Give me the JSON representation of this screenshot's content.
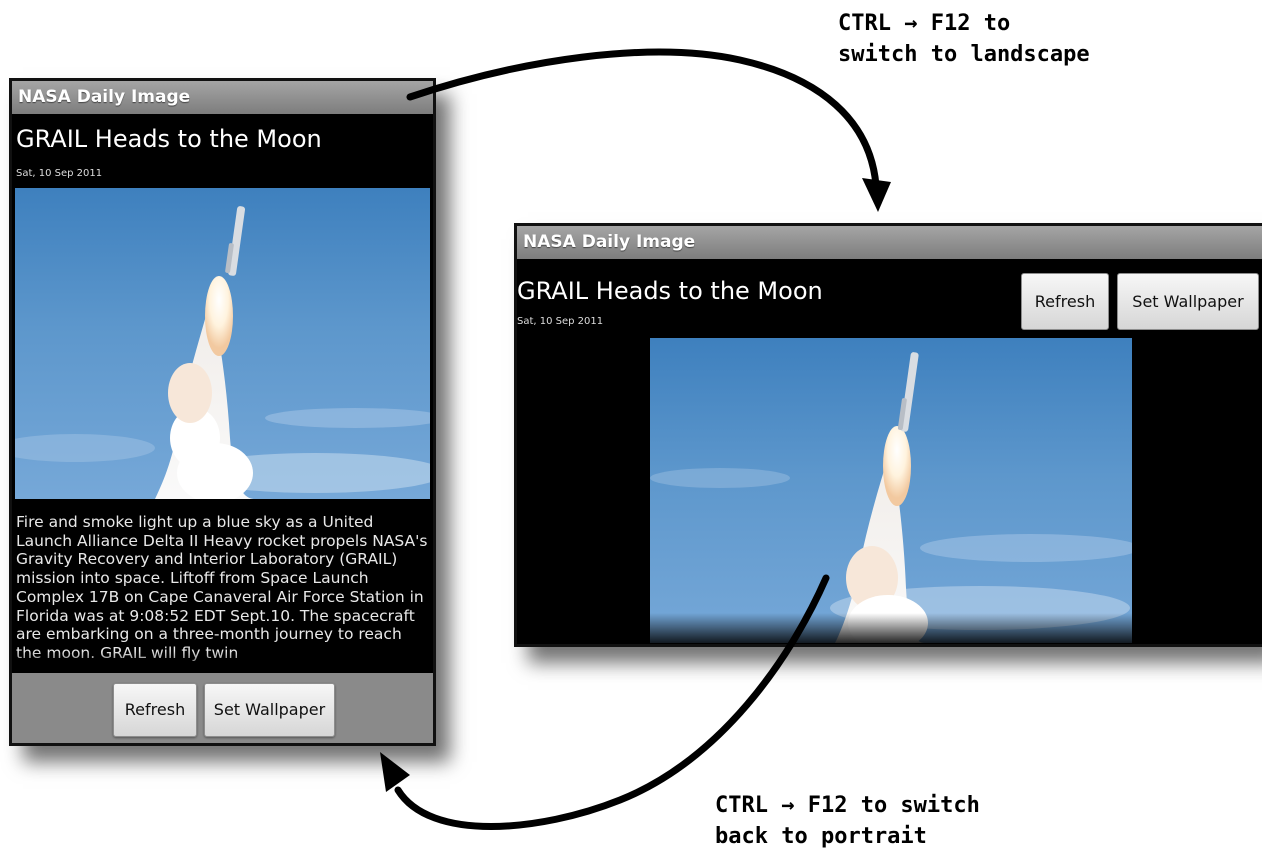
{
  "app": {
    "title": "NASA Daily Image"
  },
  "image": {
    "title": "GRAIL Heads to the Moon",
    "date": "Sat, 10 Sep 2011",
    "description": "Fire and smoke light up a blue sky as a United Launch Alliance Delta II Heavy rocket propels NASA's Gravity Recovery and Interior Laboratory (GRAIL) mission into space. Liftoff from Space Launch Complex 17B on Cape Canaveral Air Force Station in Florida was at 9:08:52 EDT Sept.10. The spacecraft are embarking on a three-month journey to reach the moon. GRAIL will fly twin"
  },
  "buttons": {
    "refresh": "Refresh",
    "set_wallpaper": "Set Wallpaper"
  },
  "annotations": {
    "to_landscape_line1": "CTRL → F12 to",
    "to_landscape_line2": "switch to landscape",
    "to_portrait_line1": "CTRL → F12 to switch",
    "to_portrait_line2": "back to portrait"
  },
  "colors": {
    "titlebar": "#8f8f8f",
    "screen_bg": "#000000",
    "sky": "#4f8cc6"
  }
}
